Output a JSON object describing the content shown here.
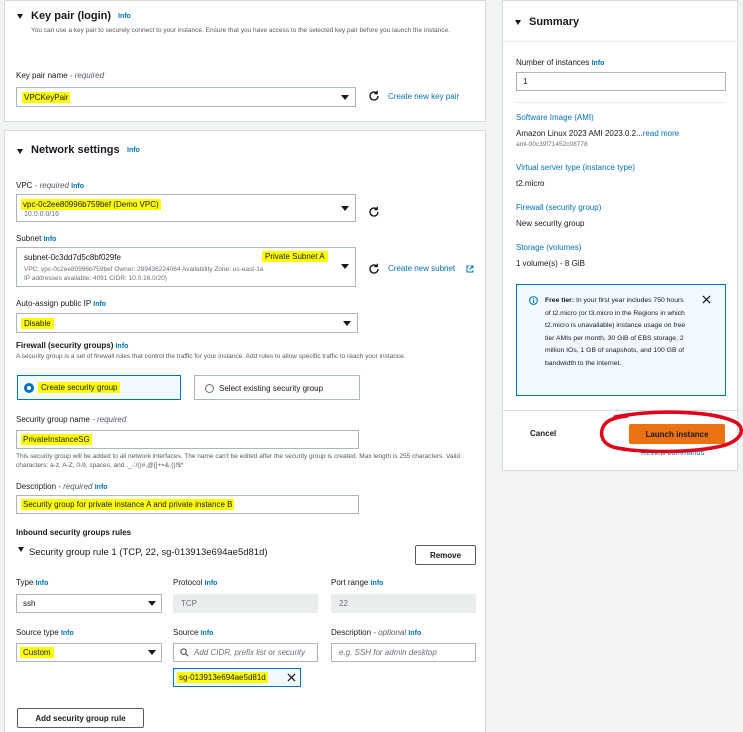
{
  "keypair": {
    "title": "Key pair (login)",
    "info": "Info",
    "description": "You can use a key pair to securely connect to your instance. Ensure that you have access to the selected key pair before you launch the instance.",
    "name_label": "Key pair name",
    "required": "- required",
    "value": "VPCKeyPair",
    "create_link": "Create new key pair"
  },
  "network": {
    "title": "Network settings",
    "info": "Info",
    "vpc_label": "VPC",
    "vpc_required": "- required",
    "vpc_info": "Info",
    "vpc_value": "vpc-0c2ee80996b759bef (Demo VPC)",
    "vpc_cidr": "10.0.0.0/16",
    "subnet_label": "Subnet",
    "subnet_info": "Info",
    "subnet_id": "subnet-0c3dd7d5c8bf029fe",
    "subnet_name": "Private Subnet A",
    "subnet_meta1": "VPC: vpc-0c2ee80996b759bef    Owner: 289436224064    Availability Zone: us-east-1a",
    "subnet_meta2": "IP addresses available: 4091    CIDR: 10.0.16.0/20)",
    "create_subnet": "Create new subnet",
    "public_ip_label": "Auto-assign public IP",
    "public_ip_info": "Info",
    "public_ip_value": "Disable",
    "firewall_label": "Firewall (security groups)",
    "firewall_info": "Info",
    "firewall_desc": "A security group is a set of firewall rules that control the traffic for your instance. Add rules to allow specific traffic to reach your instance.",
    "option_create": "Create security group",
    "option_existing": "Select existing security group",
    "sg_name_label": "Security group name",
    "sg_name_required": "- required",
    "sg_name_value": "PrivateInstanceSG",
    "sg_name_help": "This security group will be added to all network interfaces. The name can't be edited after the security group is created. Max length is 255 characters. Valid characters: a-z, A-Z, 0-9, spaces, and ._-:/()#,@[]+=&;{}!$*",
    "desc_label": "Description",
    "desc_required": "- required",
    "desc_info": "Info",
    "desc_value": "Security group for private instance A and private instance B",
    "inbound_title": "Inbound security groups rules",
    "rule_title": "Security group rule 1 (TCP, 22, sg-013913e694ae5d81d)",
    "remove_label": "Remove",
    "type_label": "Type",
    "type_info": "Info",
    "type_value": "ssh",
    "protocol_label": "Protocol",
    "protocol_info": "Info",
    "protocol_value": "TCP",
    "port_label": "Port range",
    "port_info": "Info",
    "port_value": "22",
    "source_type_label": "Source type",
    "source_type_info": "Info",
    "source_type_value": "Custom",
    "source_label": "Source",
    "source_info": "Info",
    "source_placeholder": "Add CIDR, prefix list or security",
    "source_token": "sg-013913e694ae5d81d",
    "rule_desc_label": "Description",
    "rule_desc_optional": "- optional",
    "rule_desc_info": "Info",
    "rule_desc_placeholder": "e.g. SSH for admin desktop",
    "add_rule": "Add security group rule"
  },
  "summary": {
    "title": "Summary",
    "instances_label": "Number of instances",
    "instances_info": "Info",
    "instances_value": "1",
    "ami_label": "Software Image (AMI)",
    "ami_value": "Amazon Linux 2023 AMI 2023.0.2...",
    "read_more": "read more",
    "ami_id": "ami-00c39f71452c08778",
    "type_label": "Virtual server type (instance type)",
    "type_value": "t2.micro",
    "firewall_label": "Firewall (security group)",
    "firewall_value": "New security group",
    "storage_label": "Storage (volumes)",
    "storage_value": "1 volume(s) - 8 GiB",
    "free_tier_bold": "Free tier:",
    "free_tier_text": " In your first year includes 750 hours of t2.micro (or t3.micro in the Regions in which t2.micro is unavailable) instance usage on free tier AMIs per month, 30 GiB of EBS storage, 2 million IOs, 1 GB of snapshots, and 100 GB of bandwidth to the internet.",
    "cancel": "Cancel",
    "launch": "Launch instance",
    "review": "Review commands"
  },
  "colors": {
    "accent": "#0073bb",
    "primary": "#ec7211",
    "highlight": "#ffff00",
    "annotation": "#e0001b"
  }
}
